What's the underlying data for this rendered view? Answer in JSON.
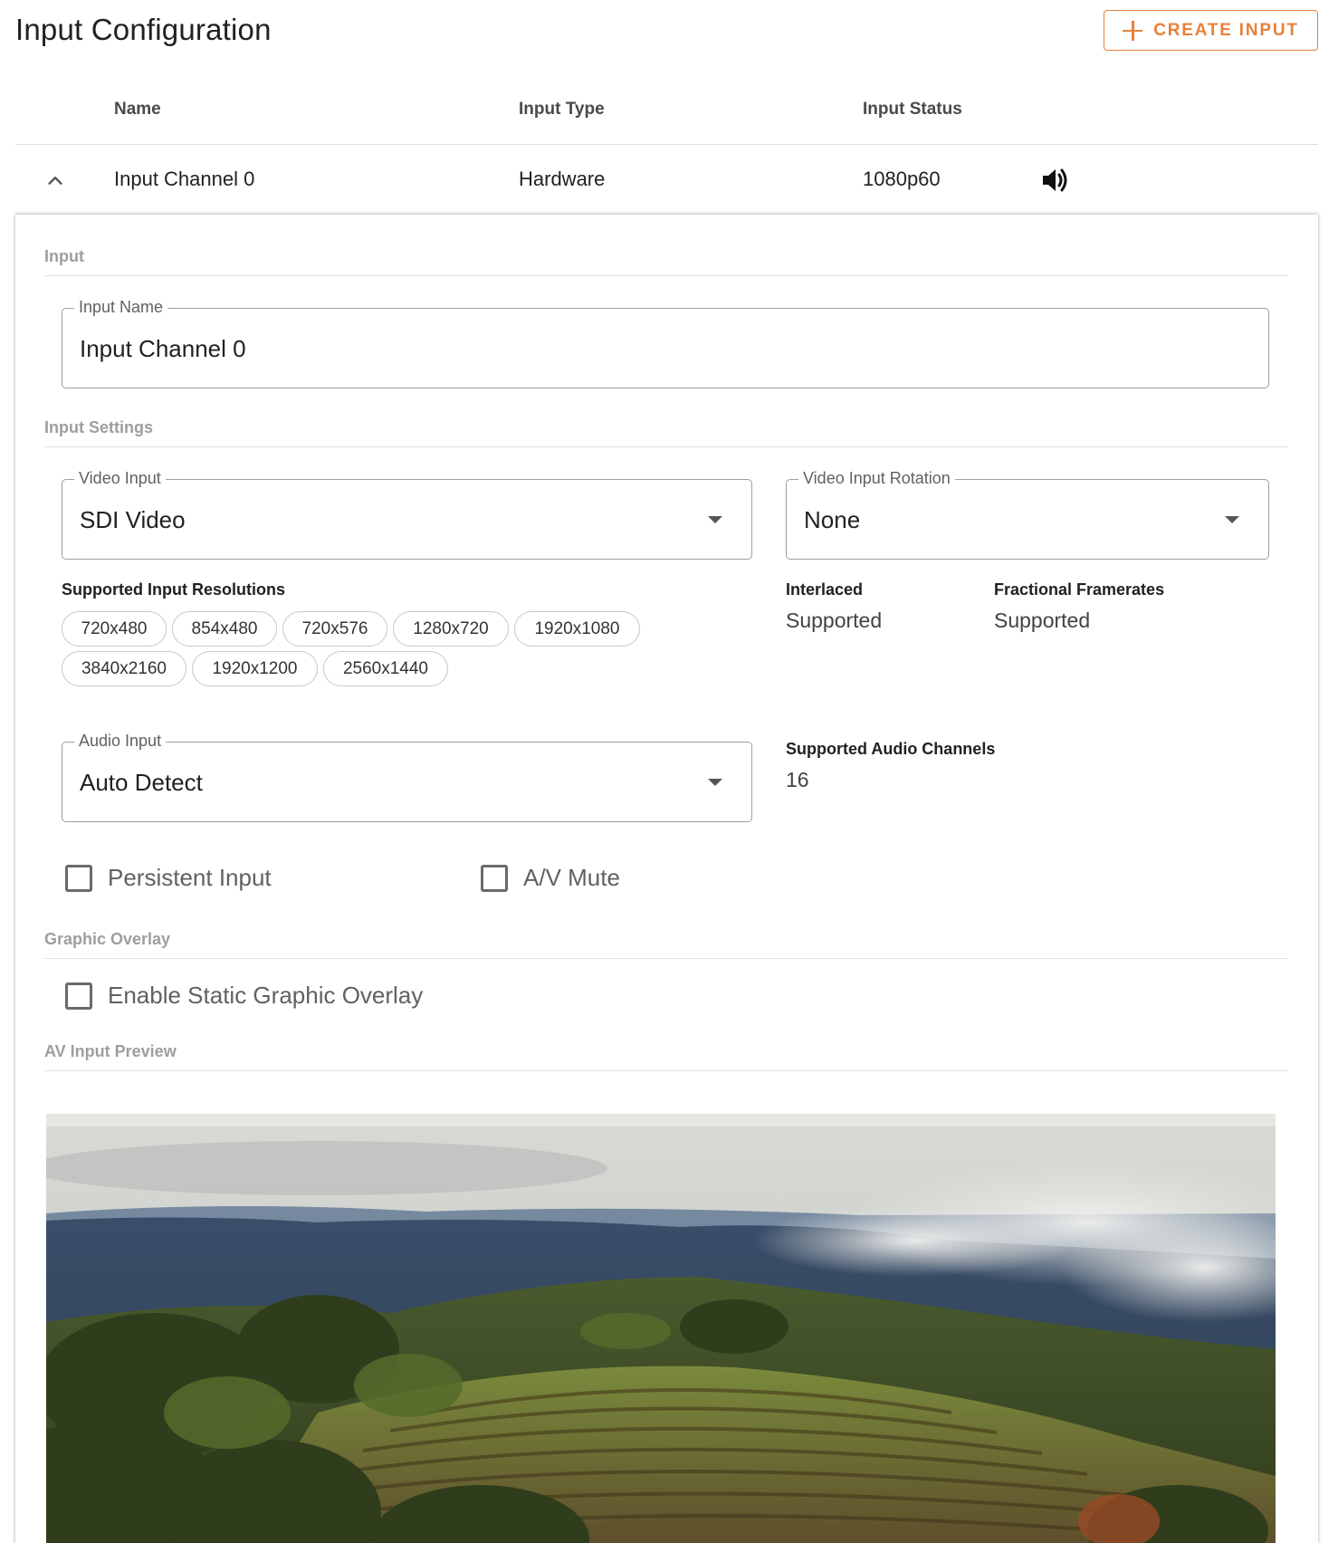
{
  "page": {
    "title": "Input Configuration"
  },
  "header": {
    "create_label": "CREATE INPUT"
  },
  "table": {
    "columns": [
      "Name",
      "Input Type",
      "Input Status"
    ],
    "row": {
      "name": "Input Channel 0",
      "type": "Hardware",
      "status": "1080p60"
    }
  },
  "sections": {
    "input": "Input",
    "input_settings": "Input Settings",
    "graphic_overlay": "Graphic Overlay",
    "av_preview": "AV Input Preview"
  },
  "input_name": {
    "label": "Input Name",
    "value": "Input Channel 0"
  },
  "video_input": {
    "label": "Video Input",
    "value": "SDI Video"
  },
  "video_rotation": {
    "label": "Video Input Rotation",
    "value": "None"
  },
  "resolutions": {
    "label": "Supported Input Resolutions",
    "items": [
      "720x480",
      "854x480",
      "720x576",
      "1280x720",
      "1920x1080",
      "3840x2160",
      "1920x1200",
      "2560x1440"
    ]
  },
  "interlaced": {
    "label": "Interlaced",
    "value": "Supported"
  },
  "fractional": {
    "label": "Fractional Framerates",
    "value": "Supported"
  },
  "audio_input": {
    "label": "Audio Input",
    "value": "Auto Detect"
  },
  "audio_channels": {
    "label": "Supported Audio Channels",
    "value": "16"
  },
  "checkboxes": {
    "persistent": {
      "label": "Persistent Input",
      "checked": false
    },
    "av_mute": {
      "label": "A/V Mute",
      "checked": false
    },
    "static_overlay": {
      "label": "Enable Static Graphic Overlay",
      "checked": false
    }
  },
  "colors": {
    "accent": "#e8803a"
  }
}
